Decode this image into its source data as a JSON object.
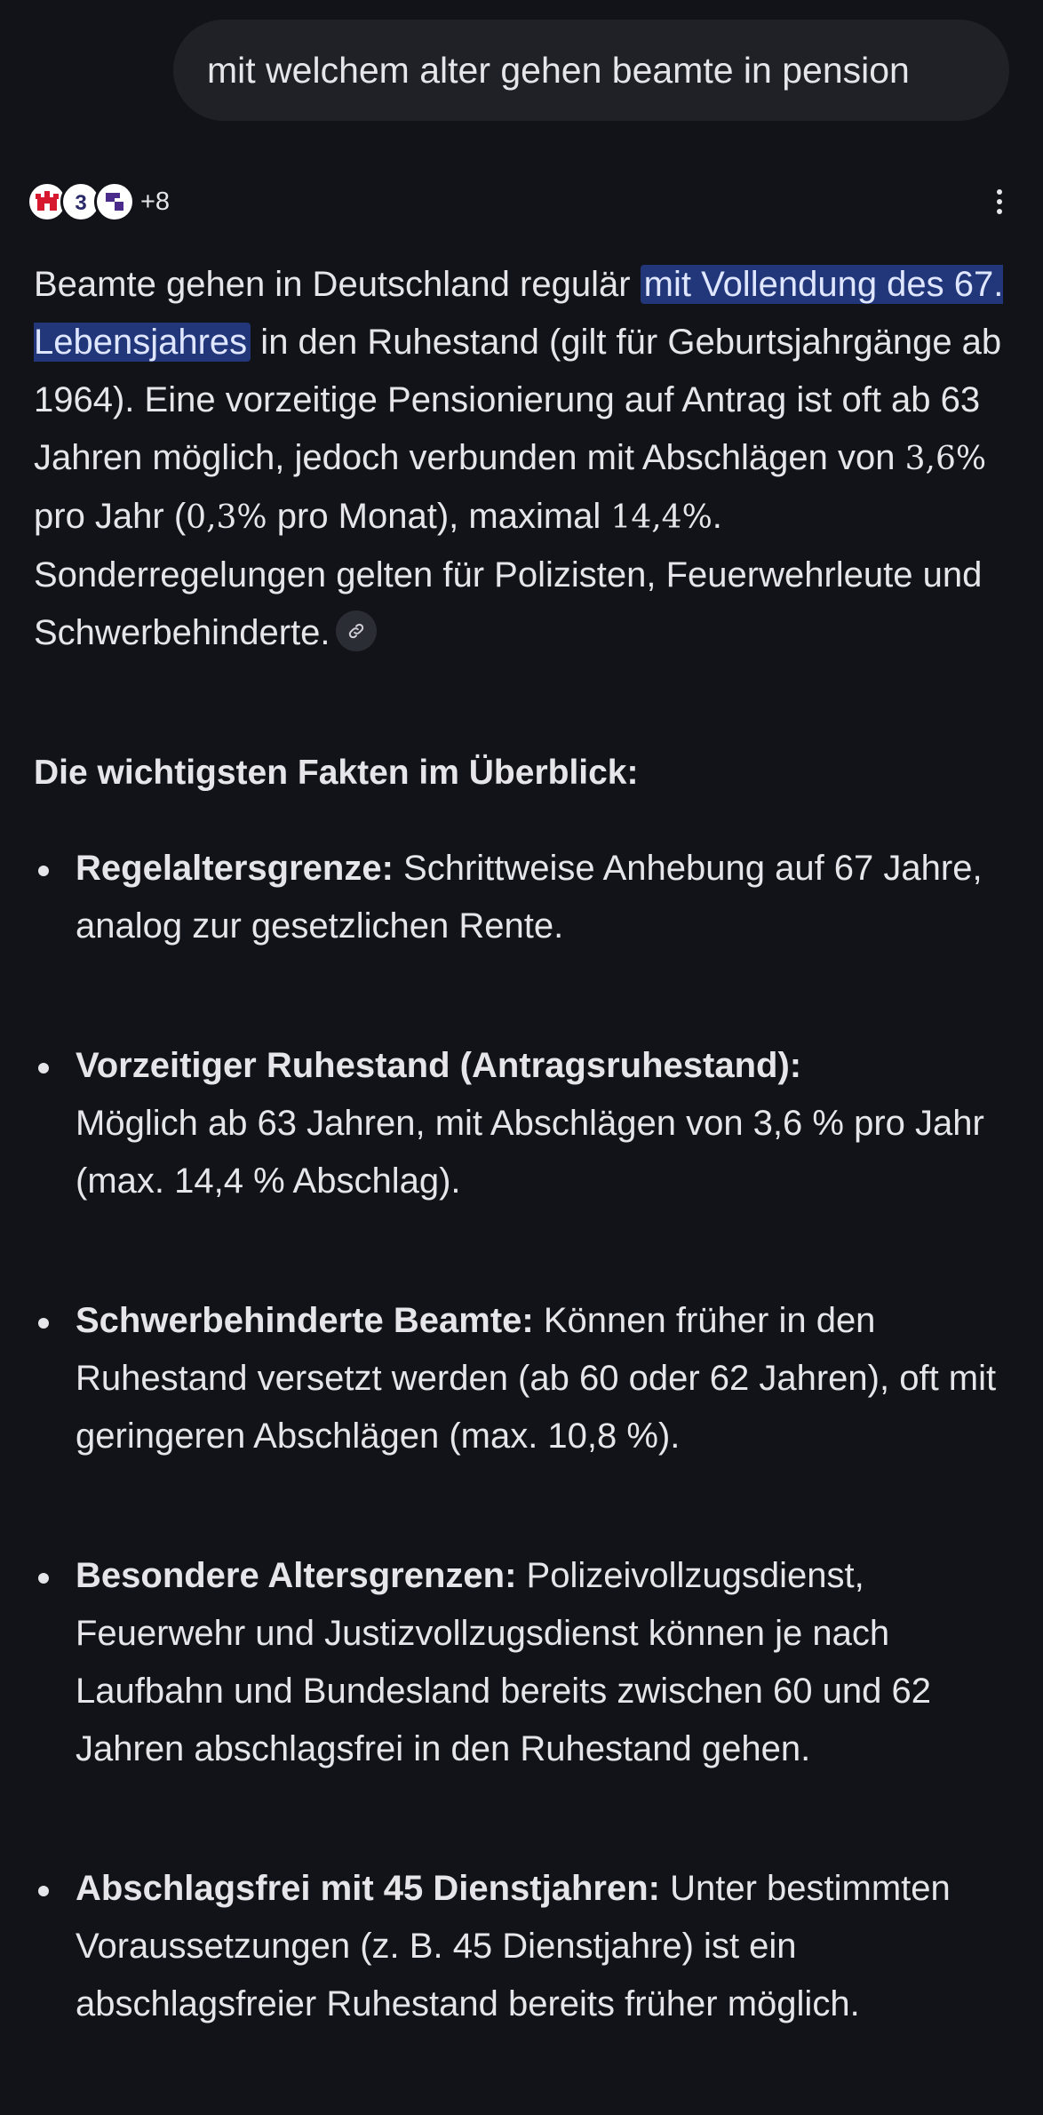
{
  "query": "mit welchem alter gehen beamte in pension",
  "sources": {
    "icons": [
      "hamburg-logo-icon",
      "three-logo-icon",
      "purple-logo-icon"
    ],
    "more_label": "+8"
  },
  "answer": {
    "intro_before": "Beamte gehen in Deutschland regulär ",
    "highlight": "mit Vollendung des 67. Lebensjahres",
    "intro_after_1": " in den Ruhestand (gilt für Geburtsjahrgänge ab 1964). Eine vorzeitige Pensionierung auf Antrag ist oft ab 63 Jahren möglich, jedoch verbunden mit Abschlägen von ",
    "math_1": "3,6%",
    "intro_after_2": " pro Jahr (",
    "math_2": "0,3%",
    "intro_after_3": " pro Monat), maximal ",
    "math_3": "14,4%",
    "intro_after_4": ". Sonderregelungen gelten für Polizisten, Feuerwehrleute und Schwerbehinderte."
  },
  "facts_heading": "Die wichtigsten Fakten im Überblick:",
  "facts": [
    {
      "term": "Regelaltersgrenze:",
      "text": " Schrittweise Anhebung auf 67 Jahre, analog zur gesetzlichen Rente."
    },
    {
      "term": "Vorzeitiger Ruhestand (Antragsruhestand):",
      "text": " Möglich ab 63 Jahren, mit Abschlägen von 3,6 % pro Jahr (max. 14,4 % Abschlag)."
    },
    {
      "term": "Schwerbehinderte Beamte:",
      "text": " Können früher in den Ruhestand versetzt werden (ab 60 oder 62 Jahren), oft mit geringeren Abschlägen (max. 10,8 %)."
    },
    {
      "term": "Besondere Altersgrenzen:",
      "text": " Polizeivollzugsdienst, Feuerwehr und Justizvollzugsdienst können je nach Laufbahn und Bundesland bereits zwischen 60 und 62 Jahren abschlagsfrei in den Ruhestand gehen."
    },
    {
      "term": "Abschlagsfrei mit 45 Dienstjahren:",
      "text": " Unter bestimmten Voraussetzungen (z. B. 45 Dienstjahre) ist ein abschlagsfreier Ruhestand bereits früher möglich."
    }
  ],
  "colors": {
    "background": "#121318",
    "bubble": "#1f2127",
    "highlight": "#22367a",
    "text": "#e6e6ea"
  }
}
